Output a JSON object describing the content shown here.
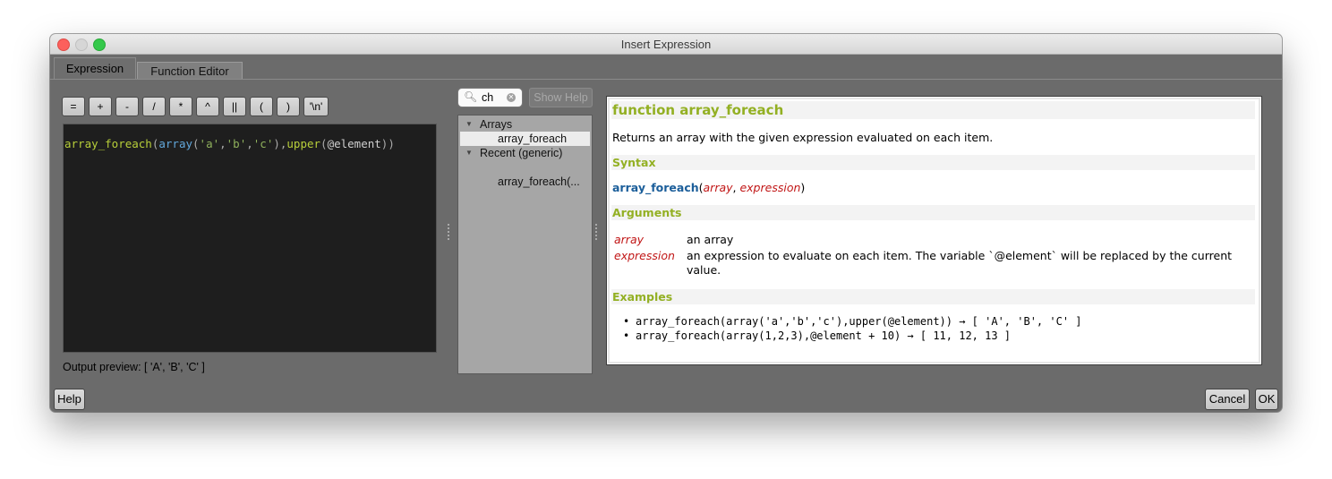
{
  "window": {
    "title": "Insert Expression"
  },
  "tabs": [
    {
      "label": "Expression"
    },
    {
      "label": "Function Editor"
    }
  ],
  "operators": [
    "=",
    "+",
    "-",
    "/",
    "*",
    "^",
    "||",
    "(",
    ")",
    "'\\n'"
  ],
  "editor": {
    "parts": [
      {
        "text": "array_foreach",
        "cls": "c-fn"
      },
      {
        "text": "(",
        "cls": "c-punct"
      },
      {
        "text": "array",
        "cls": "c-fn2"
      },
      {
        "text": "(",
        "cls": "c-punct"
      },
      {
        "text": "'a'",
        "cls": "c-str"
      },
      {
        "text": ",",
        "cls": "c-punct"
      },
      {
        "text": "'b'",
        "cls": "c-str"
      },
      {
        "text": ",",
        "cls": "c-punct"
      },
      {
        "text": "'c'",
        "cls": "c-str"
      },
      {
        "text": "),",
        "cls": "c-punct"
      },
      {
        "text": "upper",
        "cls": "c-fn"
      },
      {
        "text": "(",
        "cls": "c-punct"
      },
      {
        "text": "@element",
        "cls": "c-var"
      },
      {
        "text": "))",
        "cls": "c-punct"
      }
    ]
  },
  "preview": {
    "text": "Output preview:  [ 'A', 'B', 'C' ]"
  },
  "search": {
    "value": "ch",
    "show_help_label": "Show Help"
  },
  "tree": {
    "group_arrays": "Arrays",
    "item_foreach": "array_foreach",
    "group_recent": "Recent (generic)",
    "item_recent": "array_foreach(..."
  },
  "help": {
    "title": "function array_foreach",
    "description": "Returns an array with the given expression evaluated on each item.",
    "syntax_heading": "Syntax",
    "syntax_fn": "array_foreach",
    "syntax_open": "(",
    "syntax_arg1": "array",
    "syntax_sep": ", ",
    "syntax_arg2": "expression",
    "syntax_close": ")",
    "arguments_heading": "Arguments",
    "arg1_name": "array",
    "arg1_desc": "an array",
    "arg2_name": "expression",
    "arg2_desc": "an expression to evaluate on each item. The variable `@element` will be replaced by the current value.",
    "examples_heading": "Examples",
    "example1": "array_foreach(array('a','b','c'),upper(@element)) → [ 'A', 'B', 'C' ]",
    "example2": "array_foreach(array(1,2,3),@element + 10) → [ 11, 12, 13 ]"
  },
  "buttons": {
    "help": "Help",
    "cancel": "Cancel",
    "ok": "OK"
  }
}
